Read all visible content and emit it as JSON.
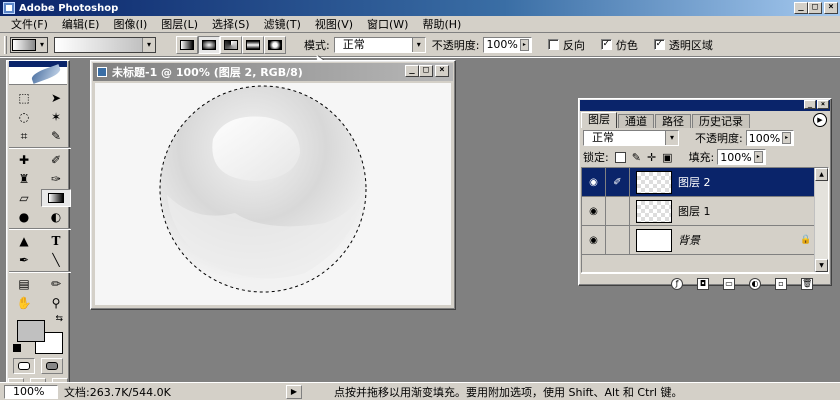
{
  "app": {
    "title": "Adobe Photoshop",
    "window_buttons": [
      "_",
      "□",
      "×"
    ]
  },
  "menu": [
    "文件(F)",
    "编辑(E)",
    "图像(I)",
    "图层(L)",
    "选择(S)",
    "滤镜(T)",
    "视图(V)",
    "窗口(W)",
    "帮助(H)"
  ],
  "options": {
    "mode_label": "模式:",
    "mode_value": "正常",
    "opacity_label": "不透明度:",
    "opacity_value": "100%",
    "reverse_label": "反向",
    "dither_label": "仿色",
    "transparency_label": "透明区域",
    "reverse_checked": false,
    "dither_checked": true,
    "transparency_checked": true
  },
  "document": {
    "title": "未标题-1 @ 100% (图层 2, RGB/8)",
    "window_buttons": [
      "_",
      "□",
      "×"
    ]
  },
  "layers_panel": {
    "tabs": [
      "图层",
      "通道",
      "路径",
      "历史记录"
    ],
    "active_tab": "图层",
    "blend_mode": "正常",
    "opacity_label": "不透明度:",
    "opacity_value": "100%",
    "lock_label": "锁定:",
    "fill_label": "填充:",
    "fill_value": "100%",
    "layers": [
      {
        "name": "图层 2",
        "selected": true,
        "transparent": true
      },
      {
        "name": "图层 1",
        "selected": false,
        "transparent": true
      },
      {
        "name": "背景",
        "selected": false,
        "transparent": false,
        "locked": true
      }
    ],
    "bottom_icons": [
      "layer-style-icon",
      "mask-icon",
      "set-icon",
      "adjustment-layer-icon",
      "new-layer-icon",
      "trash-icon"
    ]
  },
  "status": {
    "zoom": "100%",
    "doc_size": "文档:263.7K/544.0K",
    "hint": "点按并拖移以用渐变填充。要用附加选项，使用 Shift、Alt 和 Ctrl 键。"
  },
  "colors": {
    "foreground": "#c0c0c0",
    "background": "#ffffff",
    "title_active": "#0a246a"
  }
}
